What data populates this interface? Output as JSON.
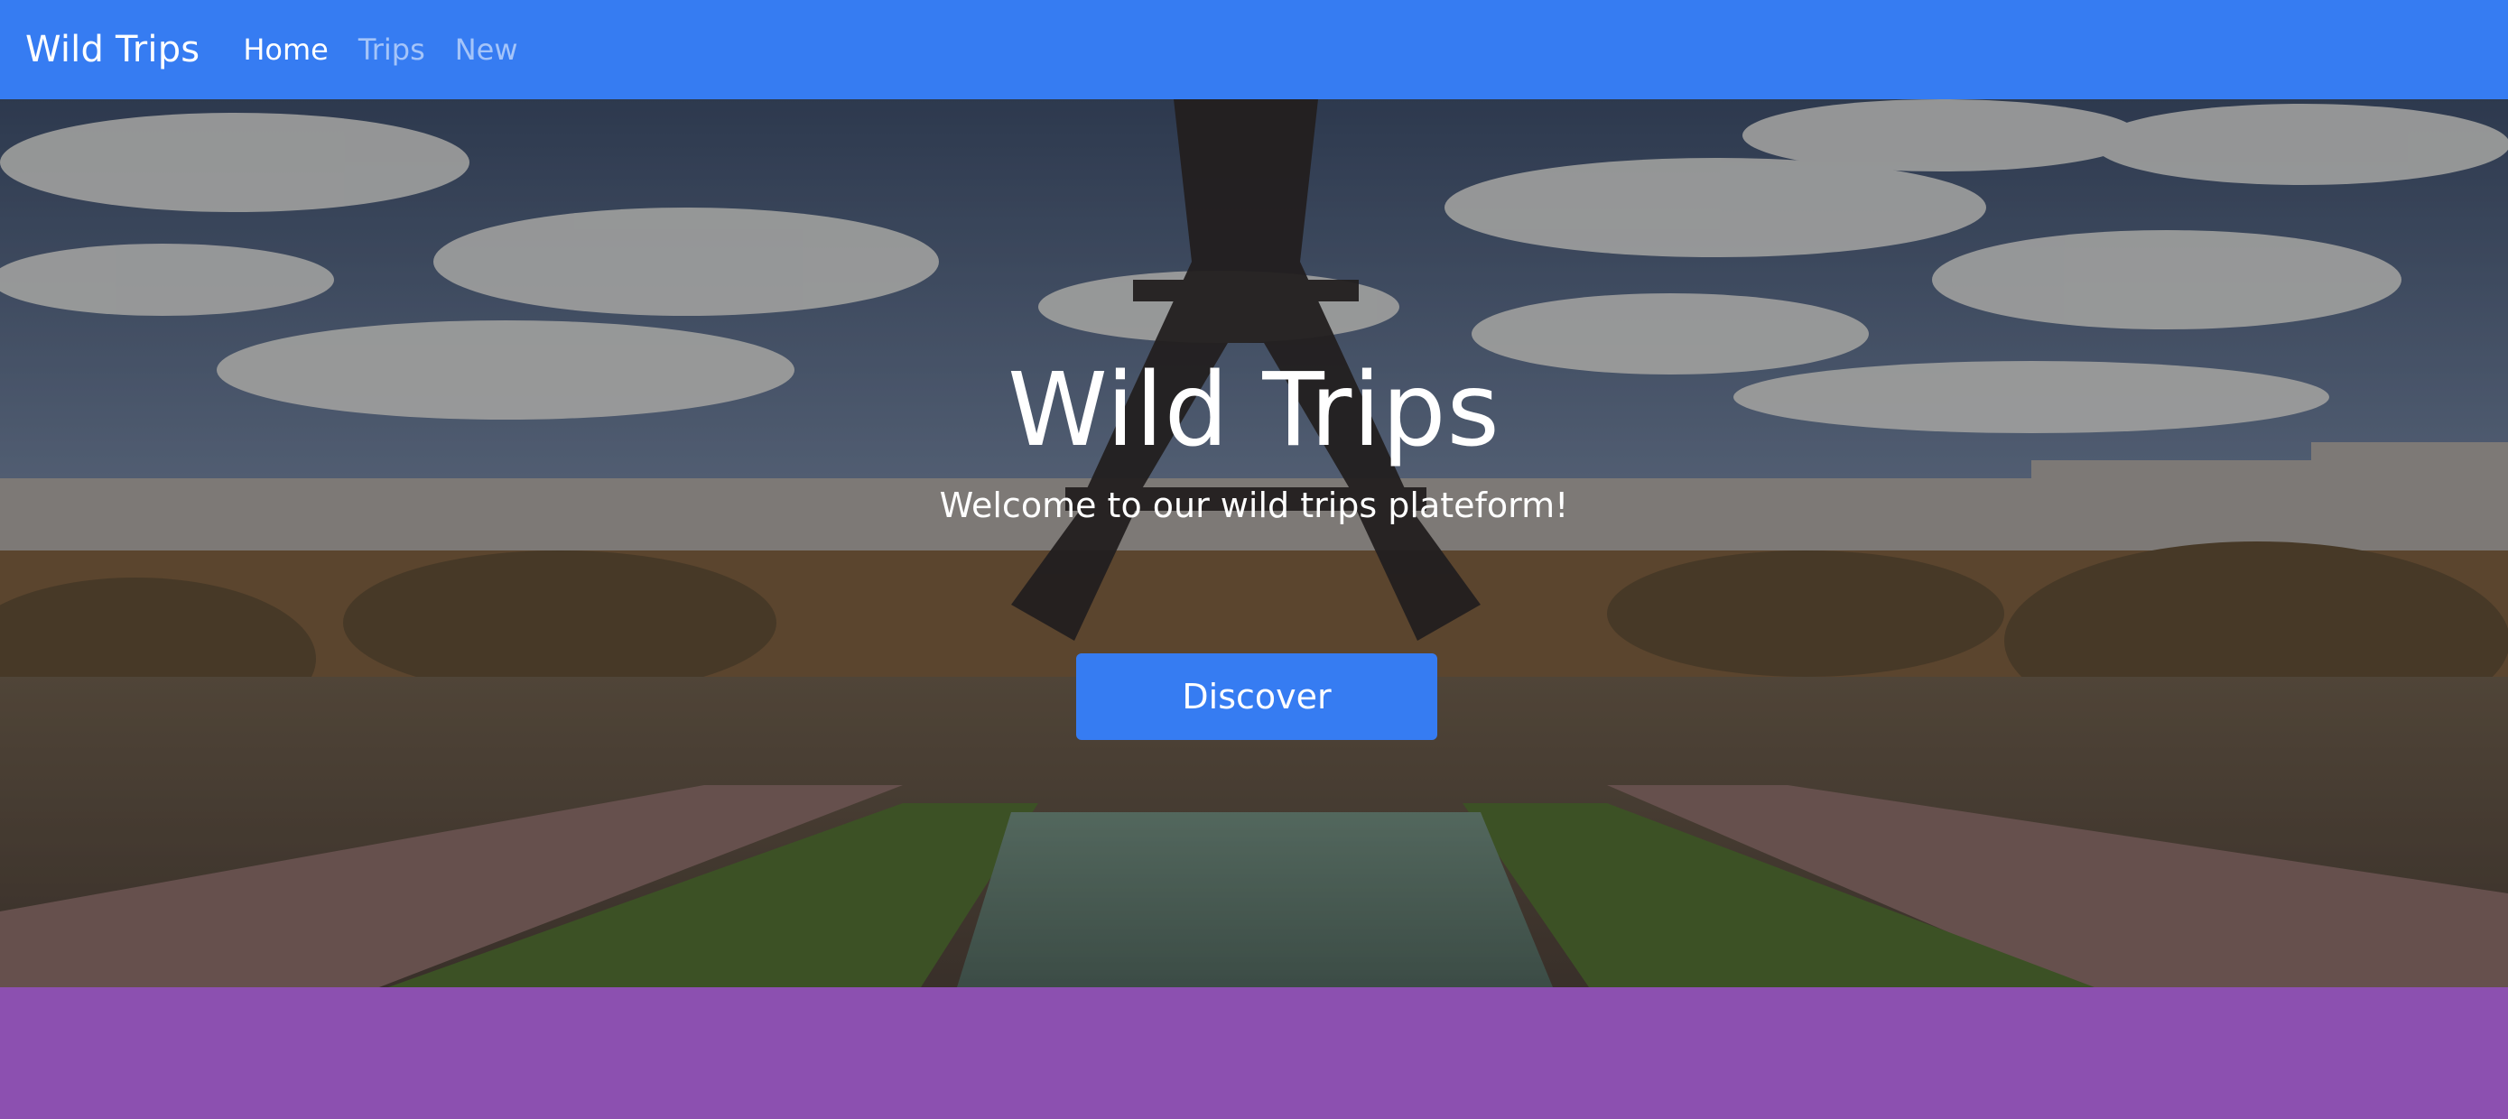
{
  "navbar": {
    "brand": "Wild Trips",
    "links": [
      {
        "label": "Home",
        "active": true
      },
      {
        "label": "Trips",
        "active": false
      },
      {
        "label": "New",
        "active": false
      }
    ]
  },
  "hero": {
    "title": "Wild Trips",
    "subtitle": "Welcome to our wild trips plateform!",
    "button_label": "Discover",
    "background_image": "eiffel-tower-paris-photo"
  },
  "colors": {
    "primary": "#367cf2",
    "footer": "#8c50b0",
    "text_light": "#ffffff"
  }
}
